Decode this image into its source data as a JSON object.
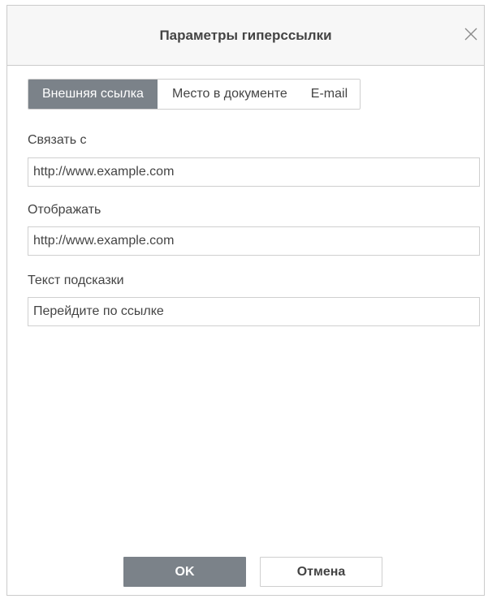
{
  "dialog": {
    "title": "Параметры гиперссылки",
    "close_icon": "close-icon"
  },
  "tabs": [
    {
      "label": "Внешняя ссылка",
      "active": true
    },
    {
      "label": "Место в документе",
      "active": false
    },
    {
      "label": "E-mail",
      "active": false
    }
  ],
  "fields": {
    "link_to": {
      "label": "Связать с",
      "value": "http://www.example.com"
    },
    "display": {
      "label": "Отображать",
      "value": "http://www.example.com"
    },
    "tooltip": {
      "label": "Текст подсказки",
      "value": "Перейдите по ссылке"
    }
  },
  "buttons": {
    "ok": "OK",
    "cancel": "Отмена"
  },
  "colors": {
    "accent": "#7b8289",
    "border": "#cfcfcf",
    "text": "#444444"
  }
}
